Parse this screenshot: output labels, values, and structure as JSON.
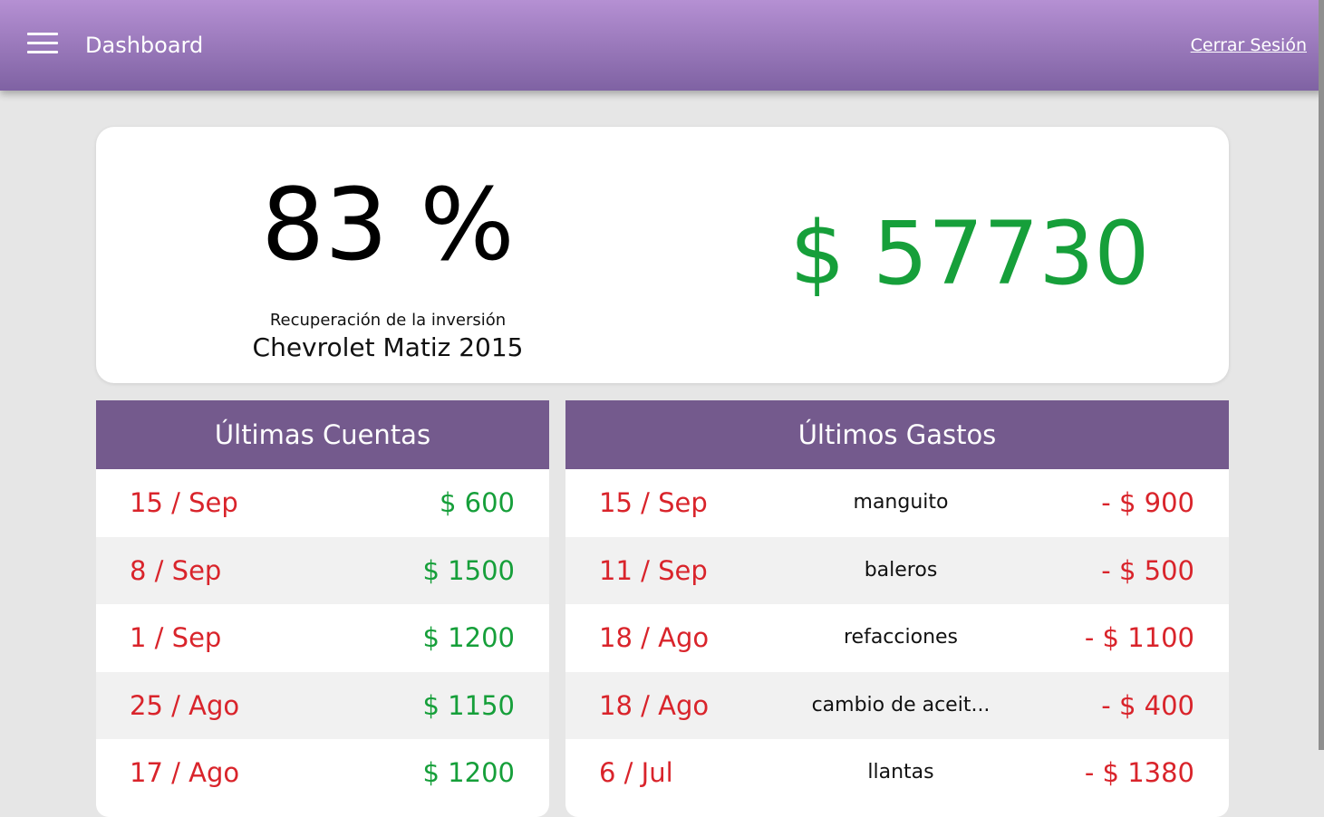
{
  "header": {
    "title": "Dashboard",
    "logout_label": "Cerrar Sesión",
    "menu_icon": "hamburger-menu-icon"
  },
  "summary": {
    "percent": "83 %",
    "recovery_label": "Recuperación de la inversión",
    "car": "Chevrolet Matiz 2015",
    "total": "$ 57730"
  },
  "accounts": {
    "title": "Últimas Cuentas",
    "rows": [
      {
        "date": "15 / Sep",
        "amount": "$ 600"
      },
      {
        "date": "8 / Sep",
        "amount": "$ 1500"
      },
      {
        "date": "1 / Sep",
        "amount": "$ 1200"
      },
      {
        "date": "25 / Ago",
        "amount": "$ 1150"
      },
      {
        "date": "17 / Ago",
        "amount": "$ 1200"
      }
    ]
  },
  "expenses": {
    "title": "Últimos Gastos",
    "rows": [
      {
        "date": "15 / Sep",
        "description": "manguito",
        "amount": "- $ 900"
      },
      {
        "date": "11 / Sep",
        "description": "baleros",
        "amount": "- $ 500"
      },
      {
        "date": "18 / Ago",
        "description": "refacciones",
        "amount": "- $ 1100"
      },
      {
        "date": "18 / Ago",
        "description": "cambio de aceit...",
        "amount": "- $ 400"
      },
      {
        "date": "6 / Jul",
        "description": "llantas",
        "amount": "- $ 1380"
      }
    ]
  },
  "colors": {
    "header_gradient_top": "#b590d3",
    "header_gradient_bottom": "#7f62a3",
    "table_header": "#745a8d",
    "positive": "#169f3a",
    "negative": "#d9242b"
  }
}
